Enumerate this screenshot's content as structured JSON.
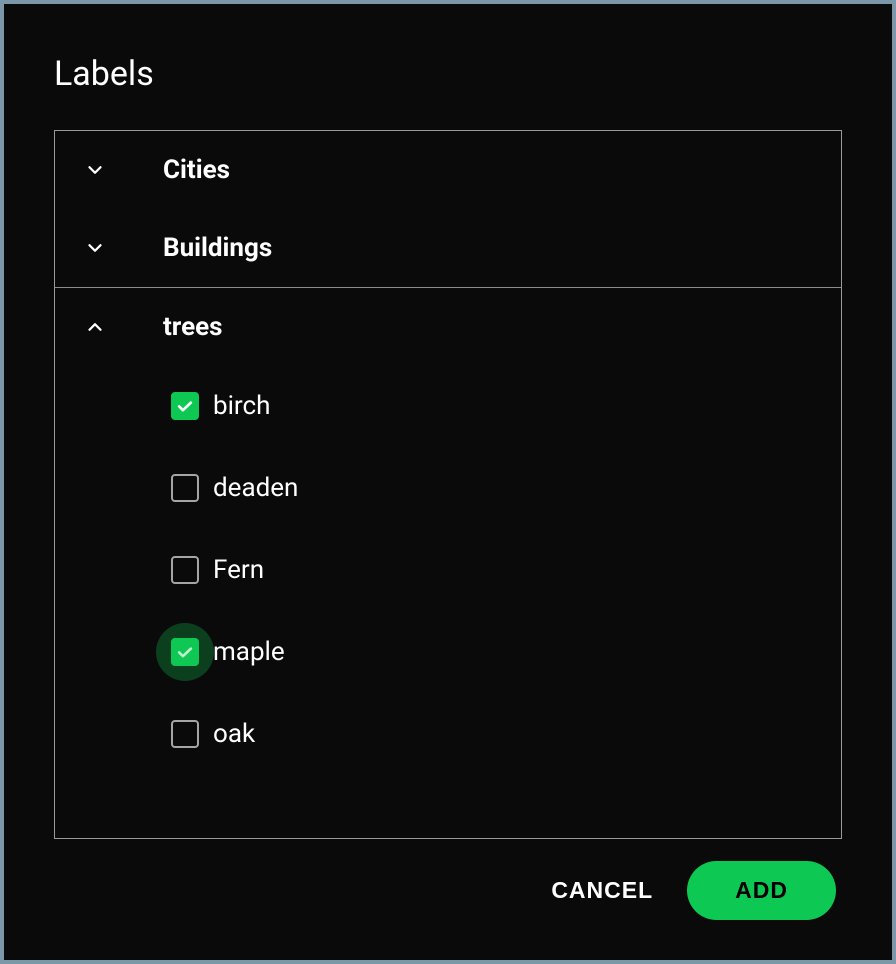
{
  "dialog": {
    "title": "Labels",
    "categories": [
      {
        "label": "Cities",
        "expanded": false
      },
      {
        "label": "Buildings",
        "expanded": false
      },
      {
        "label": "trees",
        "expanded": true,
        "items": [
          {
            "label": "birch",
            "checked": true,
            "highlighted": false
          },
          {
            "label": "deaden",
            "checked": false,
            "highlighted": false
          },
          {
            "label": "Fern",
            "checked": false,
            "highlighted": false
          },
          {
            "label": "maple",
            "checked": true,
            "highlighted": true
          },
          {
            "label": "oak",
            "checked": false,
            "highlighted": false
          }
        ]
      }
    ],
    "actions": {
      "cancel_label": "CANCEL",
      "add_label": "ADD"
    }
  },
  "colors": {
    "accent": "#0ec854"
  }
}
